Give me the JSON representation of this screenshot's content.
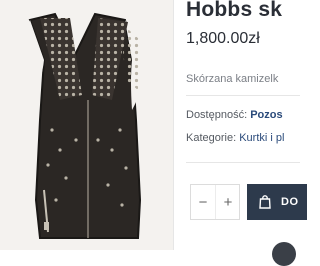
{
  "product": {
    "title": "Hobbs sk",
    "price": "1,800.00zł",
    "description": "Skórzana kamizelk",
    "availability_label": "Dostępność:",
    "availability_value": "Pozos",
    "categories_label": "Kategorie:",
    "categories_value": "Kurtki i pl"
  },
  "cart": {
    "minus": "−",
    "plus": "+",
    "button_label": "DO"
  },
  "icons": {
    "cart": "shopping-bag-icon"
  },
  "colors": {
    "title": "#2a2e36",
    "link": "#2a4a7a",
    "button": "#2d3a4c"
  }
}
